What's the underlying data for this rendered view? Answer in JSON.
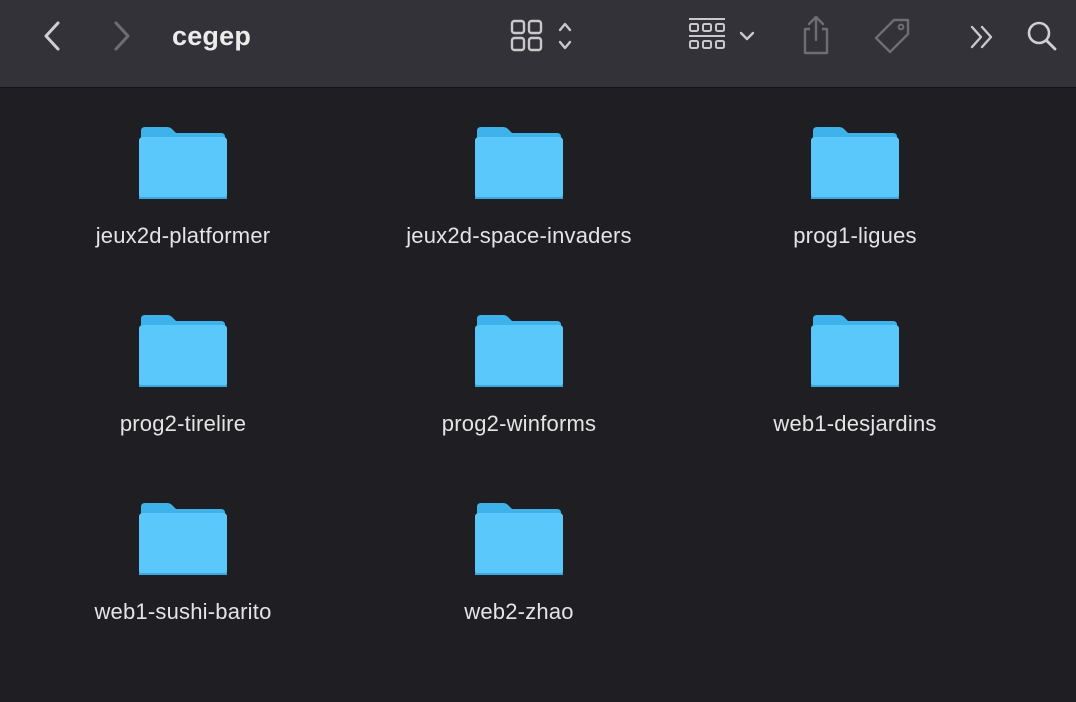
{
  "window": {
    "title": "cegep"
  },
  "toolbar": {
    "back_icon": "chevron-left-icon",
    "forward_icon": "chevron-right-icon",
    "view_icon": "grid-view-icon",
    "group_icon": "group-by-icon",
    "share_icon": "share-icon",
    "tag_icon": "tag-icon",
    "overflow_icon": "double-chevron-right-icon",
    "search_icon": "search-icon"
  },
  "folders": [
    {
      "name": "jeux2d-platformer"
    },
    {
      "name": "jeux2d-space-invaders"
    },
    {
      "name": "prog1-ligues"
    },
    {
      "name": "prog2-tirelire"
    },
    {
      "name": "prog2-winforms"
    },
    {
      "name": "web1-desjardins"
    },
    {
      "name": "web1-sushi-barito"
    },
    {
      "name": "web2-zhao"
    }
  ],
  "colors": {
    "window_bg": "#1f1e22",
    "toolbar_bg": "#333238",
    "folder_blue": "#5ac8fa",
    "folder_tab": "#3fb2ec"
  }
}
